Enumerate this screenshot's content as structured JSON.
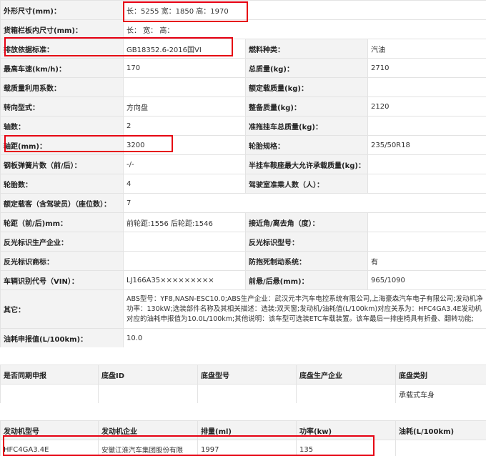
{
  "spec_rows": [
    {
      "type": "full",
      "l1": "外形尺寸(mm)：",
      "v1": "长：5255 宽：1850 高：1970"
    },
    {
      "type": "full",
      "l1": "货箱栏板内尺寸(mm)：",
      "v1": "长：  宽：  高："
    },
    {
      "type": "pair",
      "l1": "排放依据标准：",
      "v1": "GB18352.6-2016国VI",
      "l2": "燃料种类：",
      "v2": "汽油"
    },
    {
      "type": "pair",
      "l1": "最高车速(km/h)：",
      "v1": "170",
      "l2": "总质量(kg)：",
      "v2": "2710"
    },
    {
      "type": "pair",
      "l1": "载质量利用系数：",
      "v1": "",
      "l2": "额定载质量(kg)：",
      "v2": ""
    },
    {
      "type": "pair",
      "l1": "转向型式：",
      "v1": "方向盘",
      "l2": "整备质量(kg)：",
      "v2": "2120"
    },
    {
      "type": "pair",
      "l1": "轴数：",
      "v1": "2",
      "l2": "准拖挂车总质量(kg)：",
      "v2": ""
    },
    {
      "type": "pair",
      "l1": "轴距(mm)：",
      "v1": "3200",
      "l2": "轮胎规格：",
      "v2": "235/50R18"
    },
    {
      "type": "pair",
      "l1": "钢板弹簧片数（前/后）：",
      "v1": "-/-",
      "l2": "半挂车鞍座最大允许承载质量(kg)：",
      "v2": ""
    },
    {
      "type": "pair",
      "l1": "轮胎数：",
      "v1": "4",
      "l2": "驾驶室准乘人数（人）：",
      "v2": ""
    },
    {
      "type": "full",
      "l1": "额定载客（含驾驶员）（座位数）：",
      "v1": "7"
    },
    {
      "type": "pair",
      "l1": "轮距（前/后)mm：",
      "v1": "前轮距:1556 后轮距:1546",
      "l2": "接近角/离去角（度）：",
      "v2": ""
    },
    {
      "type": "pair",
      "l1": "反光标识生产企业：",
      "v1": "",
      "l2": "反光标识型号：",
      "v2": ""
    },
    {
      "type": "pair",
      "l1": "反光标识商标：",
      "v1": "",
      "l2": "防抱死制动系统：",
      "v2": "有"
    },
    {
      "type": "pair",
      "l1": "车辆识别代号（VIN）：",
      "v1": "LJ166A35×××××××××",
      "l2": "前悬/后悬(mm)：",
      "v2": "965/1090"
    },
    {
      "type": "tall",
      "l1": "其它：",
      "v1": "ABS型号：YF8,NASN-ESC10.0;ABS生产企业：武汉元丰汽车电控系统有限公司,上海豪森汽车电子有限公司;发动机净功率：130kW;选装部件名称及其相关描述：选装:双天窗;发动机/油耗值(L/100km)对应关系为：HFC4GA3.4E发动机对应的油耗申报值为10.0L/100km;其他说明：该车型可选装ETC车载装置。该车最后一排座椅具有折叠、翻转功能;"
    },
    {
      "type": "full",
      "l1": "油耗申报值(L/100km)：",
      "v1": "10.0"
    }
  ],
  "chassis": {
    "headers": [
      "是否同期申报",
      "底盘ID",
      "底盘型号",
      "底盘生产企业",
      "底盘类别"
    ],
    "row": [
      "",
      "",
      "",
      "",
      "承载式车身"
    ]
  },
  "engine": {
    "headers": [
      "发动机型号",
      "发动机企业",
      "排量(ml)",
      "功率(kw)",
      "油耗(L/100km)"
    ],
    "row": [
      "HFC4GA3.4E",
      "安徽江淮汽车集团股份有限",
      "1997",
      "135",
      ""
    ]
  }
}
